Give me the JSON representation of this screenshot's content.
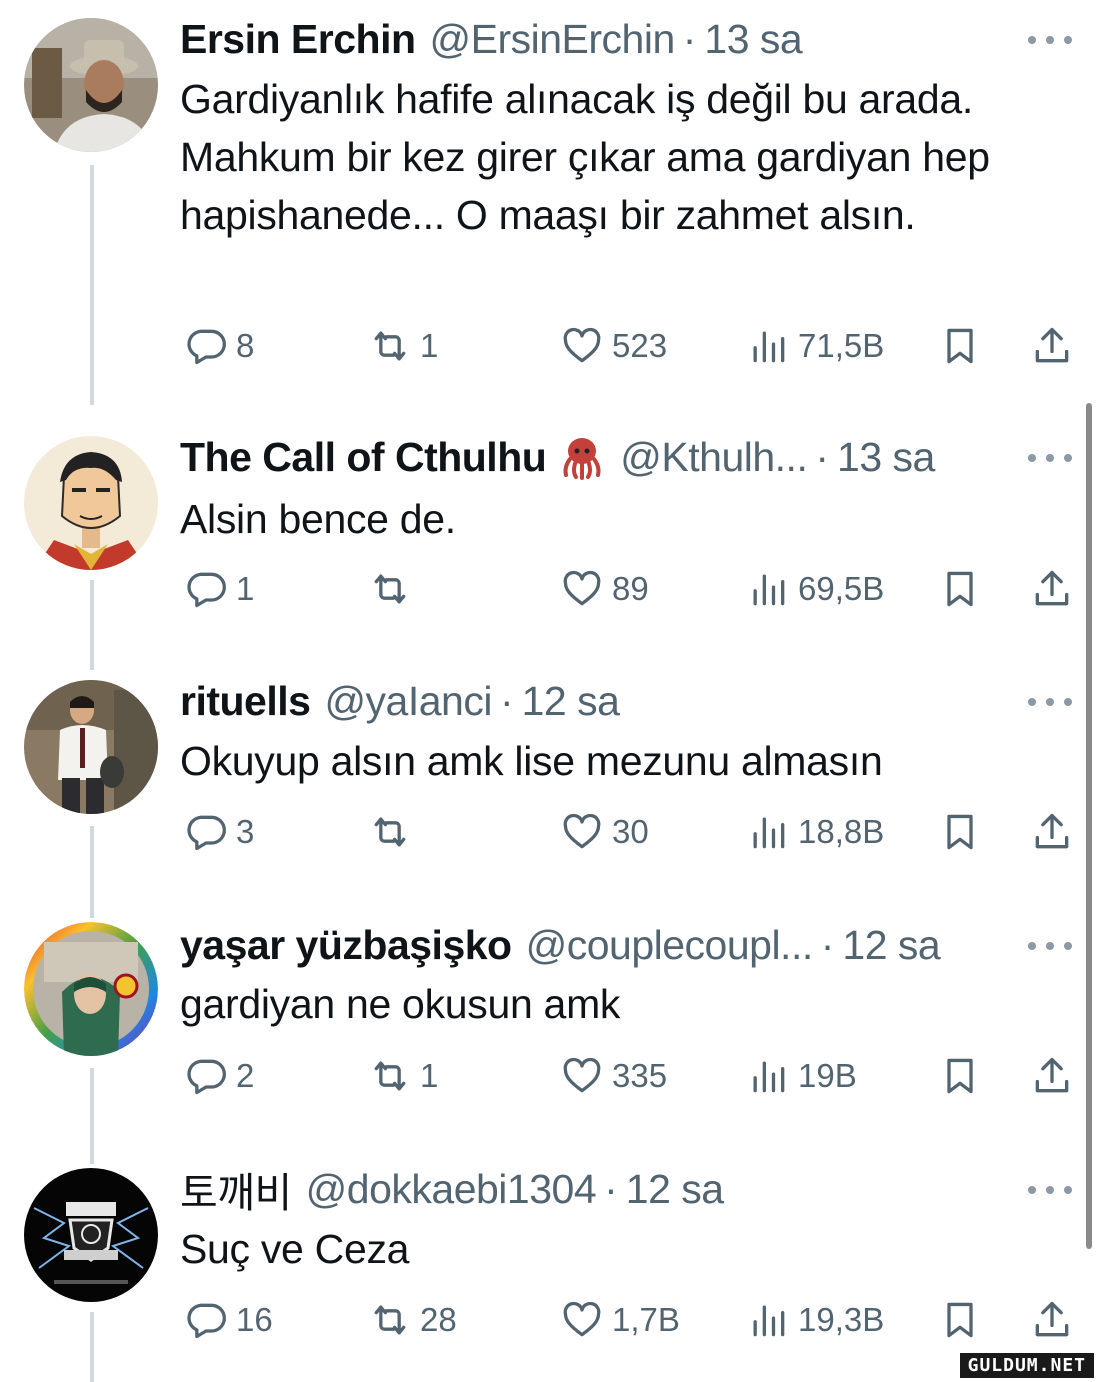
{
  "tweets": [
    {
      "name": "Ersin Erchin",
      "handle": "@ErsinErchin",
      "separator": "·",
      "time": "13 sa",
      "text": "Gardiyanlık hafife alınacak iş değil bu arada. Mahkum bir kez girer çıkar ama gardiyan hep hapishanede... O maaşı bir zahmet alsın.",
      "replies": "8",
      "retweets": "1",
      "likes": "523",
      "views": "71,5B"
    },
    {
      "name": "The Call of Cthulhu",
      "emoji_icon": "octopus-emoji",
      "handle": "@Kthulh...",
      "separator": "·",
      "time": "13 sa",
      "text": "Alsin bence de.",
      "replies": "1",
      "retweets": "",
      "likes": "89",
      "views": "69,5B"
    },
    {
      "name": "rituells",
      "handle": "@yaIanci",
      "separator": "·",
      "time": "12 sa",
      "text": "Okuyup alsın amk lise mezunu almasın",
      "replies": "3",
      "retweets": "",
      "likes": "30",
      "views": "18,8B"
    },
    {
      "name": "yaşar yüzbaşişko",
      "handle": "@couplecoupl...",
      "separator": "·",
      "time": "12 sa",
      "text": "gardiyan ne okusun amk",
      "replies": "2",
      "retweets": "1",
      "likes": "335",
      "views": "19B"
    },
    {
      "name": "토깨비",
      "handle": "@dokkaebi1304",
      "separator": "·",
      "time": "12 sa",
      "text": "Suç ve Ceza",
      "replies": "16",
      "retweets": "28",
      "likes": "1,7B",
      "views": "19,3B"
    }
  ],
  "icons": {
    "reply": "reply-icon",
    "retweet": "retweet-icon",
    "like": "heart-icon",
    "views": "views-icon",
    "bookmark": "bookmark-icon",
    "share": "share-icon",
    "more": "more-icon"
  },
  "colors": {
    "text": "#0f1419",
    "secondary": "#536471",
    "thread_line": "#cfd9de"
  },
  "watermark": "GULDUM.NET"
}
